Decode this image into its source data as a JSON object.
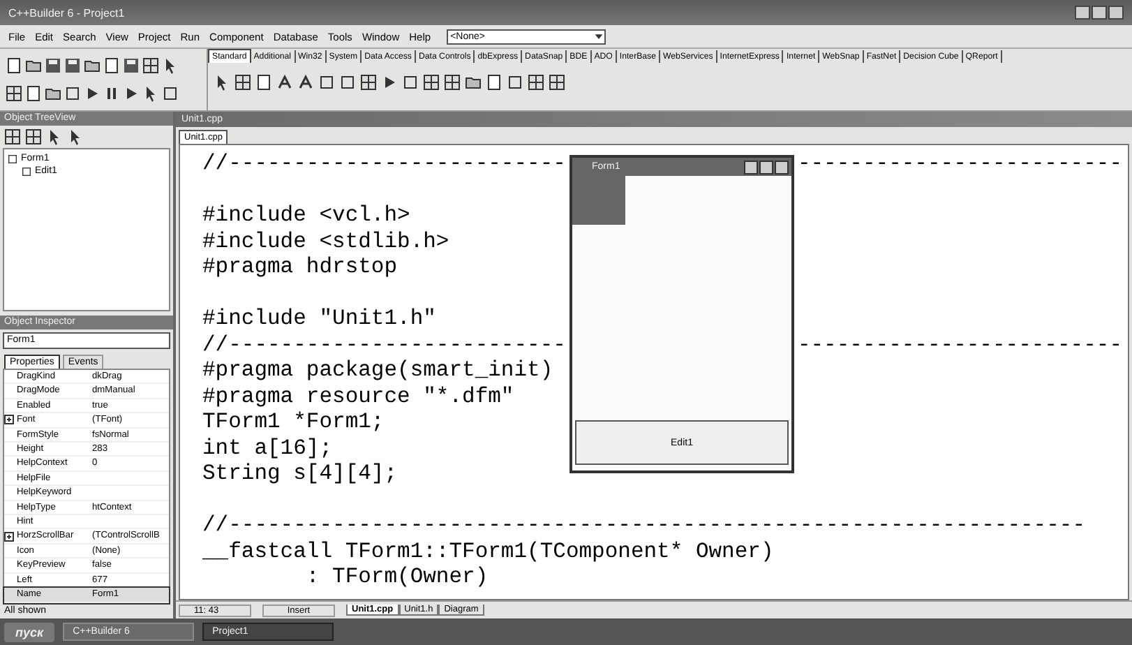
{
  "window": {
    "title": "C++Builder 6 - Project1"
  },
  "menu": [
    "File",
    "Edit",
    "Search",
    "View",
    "Project",
    "Run",
    "Component",
    "Database",
    "Tools",
    "Window",
    "Help"
  ],
  "toolbar": {
    "combo_value": "<None>"
  },
  "palette_tabs": [
    {
      "label": "Standard",
      "selected": true
    },
    {
      "label": "Additional",
      "selected": false
    },
    {
      "label": "Win32",
      "selected": false
    },
    {
      "label": "System",
      "selected": false
    },
    {
      "label": "Data Access",
      "selected": false
    },
    {
      "label": "Data Controls",
      "selected": false
    },
    {
      "label": "dbExpress",
      "selected": false
    },
    {
      "label": "DataSnap",
      "selected": false
    },
    {
      "label": "BDE",
      "selected": false
    },
    {
      "label": "ADO",
      "selected": false
    },
    {
      "label": "InterBase",
      "selected": false
    },
    {
      "label": "WebServices",
      "selected": false
    },
    {
      "label": "InternetExpress",
      "selected": false
    },
    {
      "label": "Internet",
      "selected": false
    },
    {
      "label": "WebSnap",
      "selected": false
    },
    {
      "label": "FastNet",
      "selected": false
    },
    {
      "label": "Decision Cube",
      "selected": false
    },
    {
      "label": "QReport",
      "selected": false
    }
  ],
  "object_treeview": {
    "title": "Object TreeView",
    "items": [
      {
        "label": "Form1",
        "children": [
          {
            "label": "Edit1"
          }
        ]
      }
    ]
  },
  "object_inspector": {
    "title": "Object Inspector",
    "object": "Form1",
    "tabs": [
      {
        "label": "Properties",
        "selected": true
      },
      {
        "label": "Events",
        "selected": false
      }
    ],
    "rows": [
      {
        "kind": "plain",
        "name": "DragKind",
        "value": "dkDrag",
        "selected": false
      },
      {
        "kind": "plain",
        "name": "DragMode",
        "value": "dmManual",
        "selected": false
      },
      {
        "kind": "plain",
        "name": "Enabled",
        "value": "true",
        "selected": false
      },
      {
        "kind": "group",
        "name": "Font",
        "value": "(TFont)",
        "selected": false
      },
      {
        "kind": "plain",
        "name": "FormStyle",
        "value": "fsNormal",
        "selected": false
      },
      {
        "kind": "plain",
        "name": "Height",
        "value": "283",
        "selected": false
      },
      {
        "kind": "plain",
        "name": "HelpContext",
        "value": "0",
        "selected": false
      },
      {
        "kind": "plain",
        "name": "HelpFile",
        "selected": false
      },
      {
        "kind": "plain",
        "name": "HelpKeyword",
        "selected": false
      },
      {
        "kind": "plain",
        "name": "HelpType",
        "value": "htContext",
        "selected": false
      },
      {
        "kind": "plain",
        "name": "Hint",
        "selected": false
      },
      {
        "kind": "group",
        "name": "HorzScrollBar",
        "value": "(TControlScrollB",
        "selected": false
      },
      {
        "kind": "plain",
        "name": "Icon",
        "value": "(None)",
        "selected": false
      },
      {
        "kind": "plain",
        "name": "KeyPreview",
        "value": "false",
        "selected": false
      },
      {
        "kind": "plain",
        "name": "Left",
        "value": "677",
        "selected": false
      },
      {
        "kind": "plain",
        "name": "Name",
        "value": "Form1",
        "selected": true
      }
    ],
    "footer": "All shown"
  },
  "editor": {
    "title": "Unit1.cpp",
    "tab": "Unit1.cpp",
    "lines": [
      {
        "text": "//--------------------------",
        "continuation": "-------------------------",
        "blank_before": false
      },
      {
        "text": "#include <vcl.h>",
        "blank_before": true
      },
      {
        "text": "#include <stdlib.h>",
        "blank_before": false
      },
      {
        "text": "#pragma hdrstop",
        "blank_before": false
      },
      {
        "text": "#include \"Unit1.h\"",
        "blank_before": true
      },
      {
        "text": "//--------------------------",
        "continuation": "-------------------------",
        "blank_before": false
      },
      {
        "text": "#pragma package(smart_init)",
        "blank_before": false
      },
      {
        "text": "#pragma resource \"*.dfm\"",
        "blank_before": false
      },
      {
        "text": "TForm1 *Form1;",
        "blank_before": false
      },
      {
        "text": "int a[16];",
        "blank_before": false
      },
      {
        "text": "String s[4][4];",
        "blank_before": false
      },
      {
        "text": "//------------------------------------------------------------------",
        "blank_before": true
      },
      {
        "text": "__fastcall TForm1::TForm1(TComponent* Owner)",
        "blank_before": false
      },
      {
        "text": "        : TForm(Owner)",
        "blank_before": false
      }
    ],
    "position": "11: 43",
    "mode": "Insert",
    "bottom_tabs": [
      {
        "label": "Unit1.cpp",
        "selected": true
      },
      {
        "label": "Unit1.h",
        "selected": false
      },
      {
        "label": "Diagram",
        "selected": false
      }
    ]
  },
  "form_window": {
    "title": "Form1",
    "edit_value": "Edit1"
  },
  "taskbar": {
    "start": "пуск",
    "items": [
      {
        "label": "C++Builder 6",
        "selected": false
      },
      {
        "label": "Project1",
        "selected": true
      }
    ]
  }
}
